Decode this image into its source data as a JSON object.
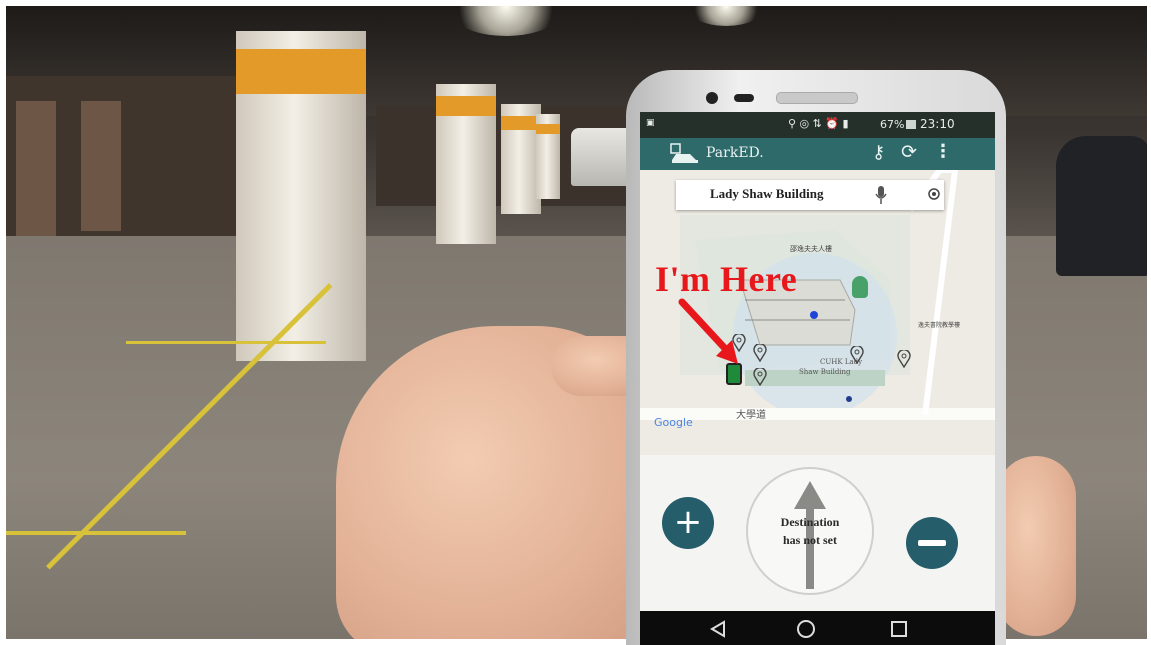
{
  "annotation": {
    "text": "I'm Here"
  },
  "status_bar": {
    "battery": "67%",
    "time": "23:10"
  },
  "app": {
    "title": "ParkED."
  },
  "search": {
    "value": "Lady Shaw Building"
  },
  "map": {
    "label_top": "邵逸夫夫人樓",
    "label_right": "逸夫書院教學樓",
    "building_label_line1": "CUHK Lady",
    "building_label_line2": "Shaw Building",
    "road_label": "大學道",
    "google_logo": "Google"
  },
  "compass": {
    "line1": "Destination",
    "line2": "has not set"
  },
  "icons": [
    "parking-car-icon",
    "key-icon",
    "refresh-icon",
    "more-vert-icon",
    "mic-icon",
    "my-location-icon",
    "zoom-in-icon",
    "zoom-out-icon",
    "back-icon",
    "home-icon",
    "recents-icon"
  ],
  "colors": {
    "app_bar": "#2f6a6b",
    "status_bar": "#25302b",
    "annotation": "#e8171b",
    "fab": "#255d6a"
  }
}
